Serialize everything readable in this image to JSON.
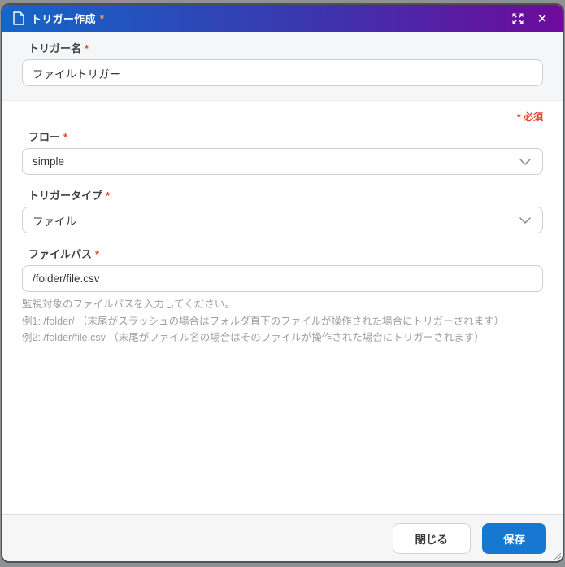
{
  "dialog": {
    "title": "トリガー作成",
    "required_marker": "*",
    "required_note": "* 必須",
    "close_glyph": "✕"
  },
  "fields": {
    "trigger_name": {
      "label": "トリガー名",
      "value": "ファイルトリガー"
    },
    "flow": {
      "label": "フロー",
      "value": "simple"
    },
    "trigger_type": {
      "label": "トリガータイプ",
      "value": "ファイル"
    },
    "file_path": {
      "label": "ファイルパス",
      "value": "/folder/file.csv",
      "help": [
        "監視対象のファイルパスを入力してください。",
        "例1: /folder/ （末尾がスラッシュの場合はフォルダ直下のファイルが操作された場合にトリガーされます）",
        "例2: /folder/file.csv （末尾がファイル名の場合はそのファイルが操作された場合にトリガーされます）"
      ]
    }
  },
  "footer": {
    "close_label": "閉じる",
    "save_label": "保存"
  },
  "colors": {
    "header_gradient_start": "#1366c9",
    "header_gradient_end": "#6e0a9c",
    "required_red": "#e5492f",
    "title_asterisk_orange": "#ffa733",
    "save_button_blue": "#1778d2"
  }
}
